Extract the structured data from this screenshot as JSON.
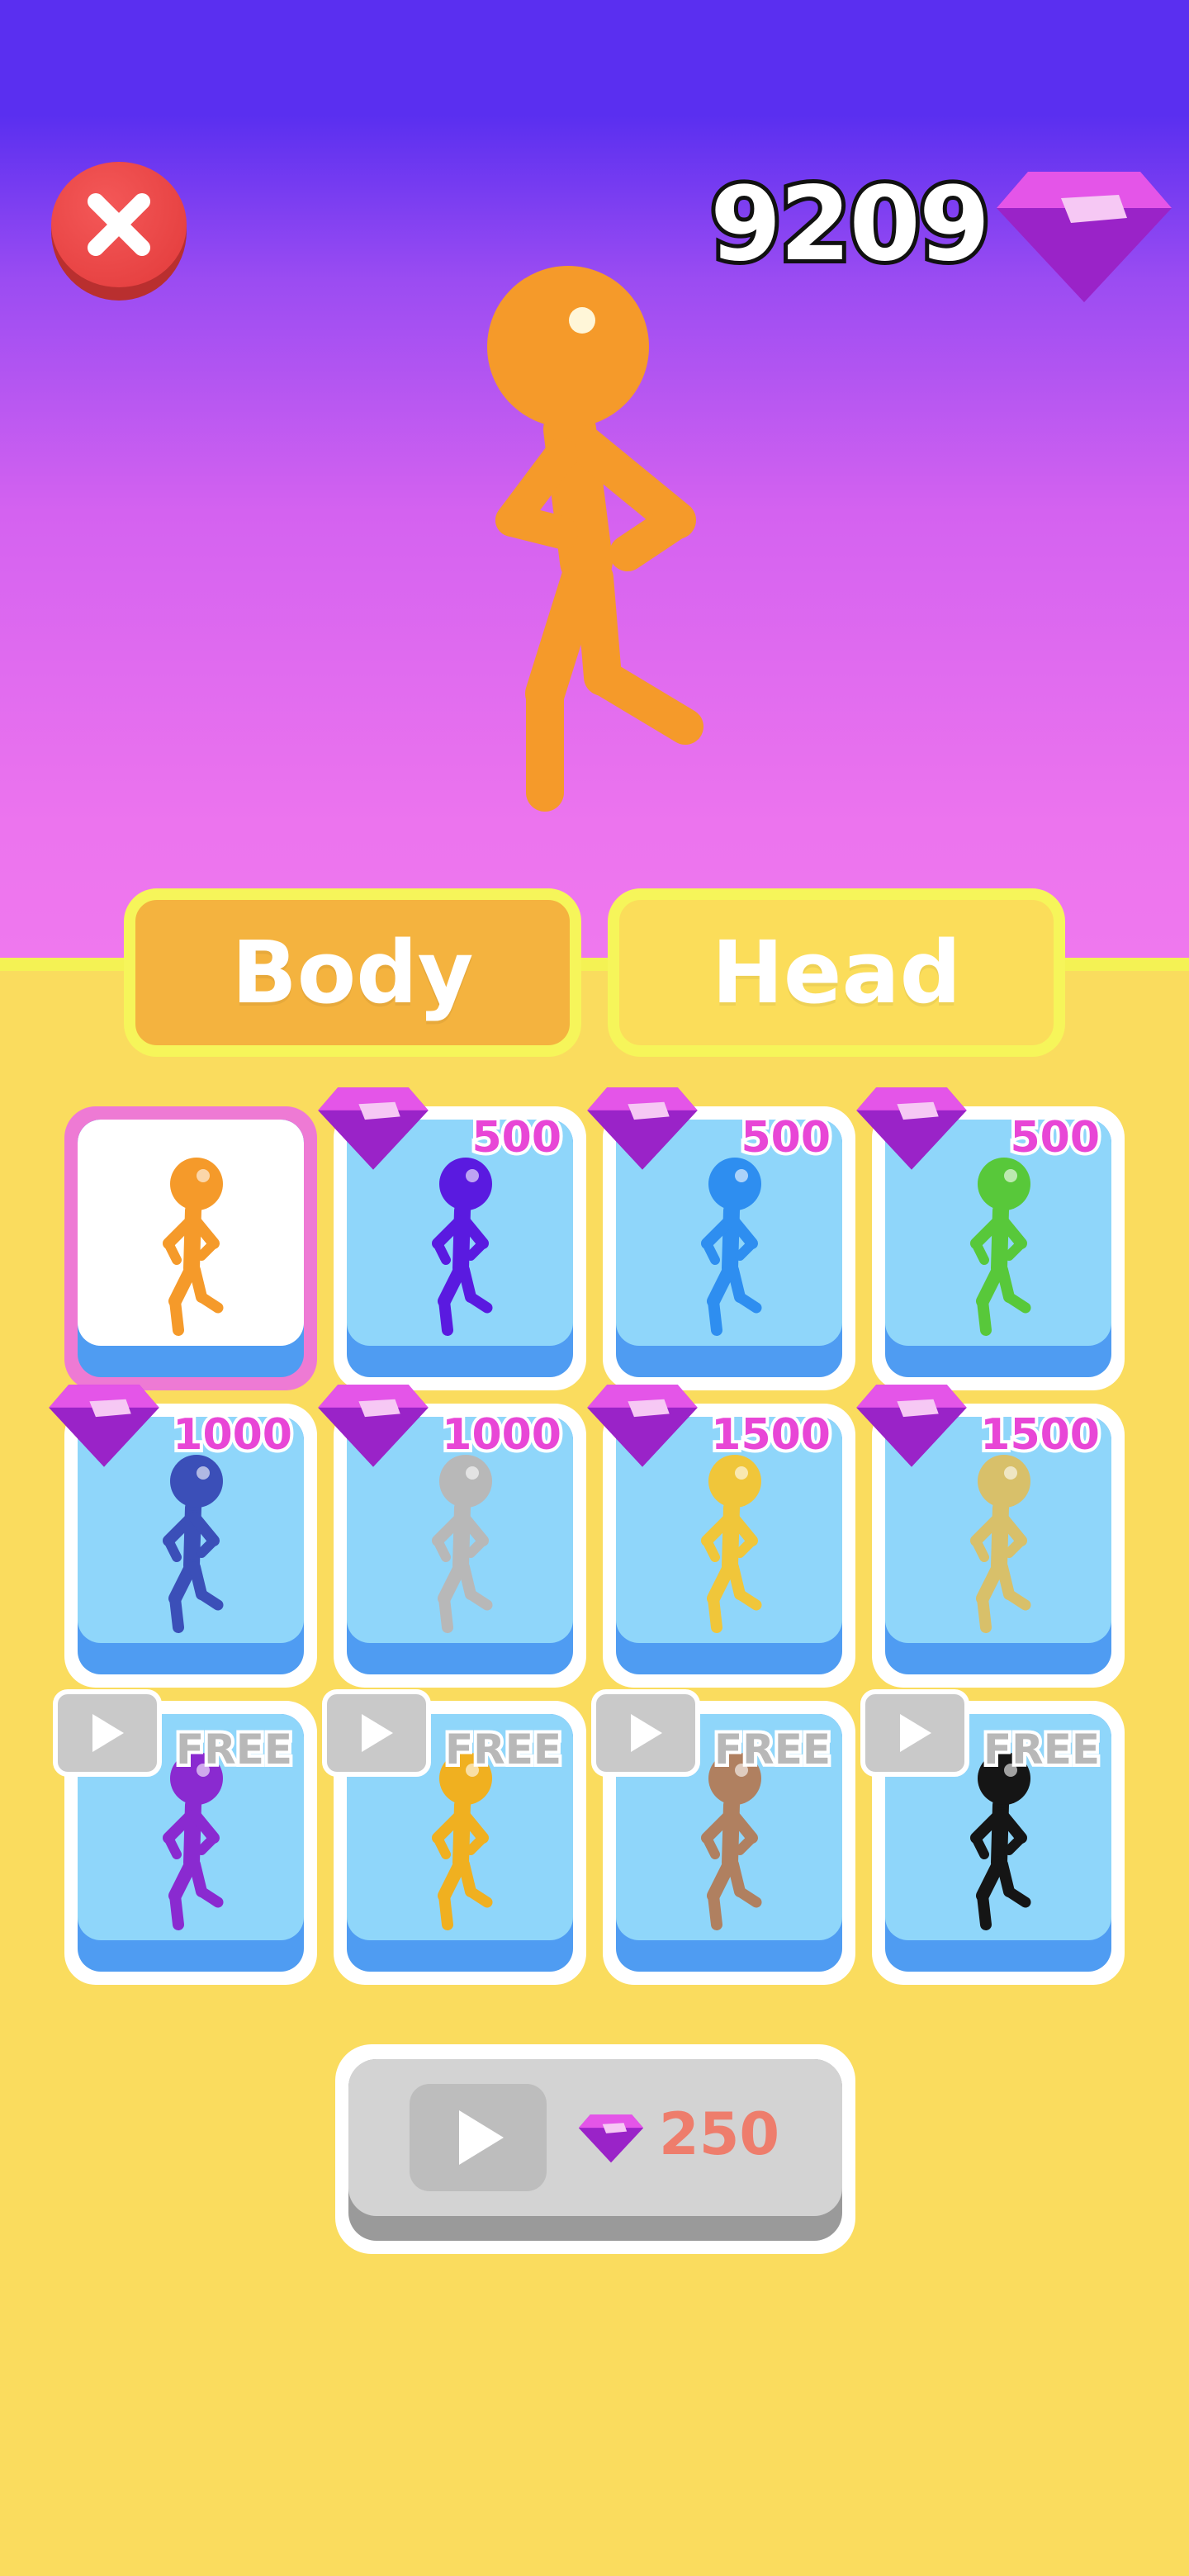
{
  "header": {
    "gem_balance": "9209",
    "close_icon": "close-icon",
    "currency_icon": "gem-icon"
  },
  "tabs": [
    {
      "label": "Body",
      "active": true
    },
    {
      "label": "Head",
      "active": false
    }
  ],
  "skins": [
    {
      "color": "#f59a2a",
      "state": "selected",
      "price": null
    },
    {
      "color": "#5a1ae0",
      "state": "gems",
      "price": "500"
    },
    {
      "color": "#2e8ef0",
      "state": "gems",
      "price": "500"
    },
    {
      "color": "#58c83a",
      "state": "gems",
      "price": "500"
    },
    {
      "color": "#3b4fb8",
      "state": "gems",
      "price": "1000"
    },
    {
      "color": "#b8b8b8",
      "state": "gems",
      "price": "1000"
    },
    {
      "color": "#f0c63a",
      "state": "gems",
      "price": "1500"
    },
    {
      "color": "#d8c06a",
      "state": "gems",
      "price": "1500"
    },
    {
      "color": "#8a2ad0",
      "state": "ad",
      "price": "FREE"
    },
    {
      "color": "#f0b020",
      "state": "ad",
      "price": "FREE"
    },
    {
      "color": "#b08060",
      "state": "ad",
      "price": "FREE"
    },
    {
      "color": "#151515",
      "state": "ad",
      "price": "FREE"
    }
  ],
  "unlock_button": {
    "cost": "250",
    "icon": "play-icon"
  },
  "colors": {
    "gem": "#d93fe0",
    "card_blue": "#8fd6fa",
    "selected_border": "#ee7ad4",
    "tab_active": "#f4b33f",
    "background": "#fadc5e"
  }
}
